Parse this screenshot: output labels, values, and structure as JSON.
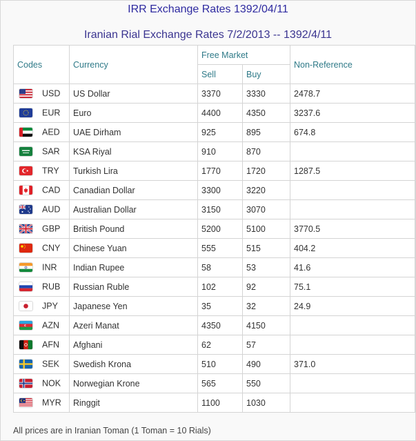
{
  "page": {
    "title": "IRR Exchange Rates 1392/04/11",
    "subtitle": "Iranian Rial Exchange Rates 7/2/2013 -- 1392/4/11",
    "footer": "All prices are in Iranian Toman (1 Toman = 10 Rials)"
  },
  "headers": {
    "codes": "Codes",
    "currency": "Currency",
    "free_market": "Free Market",
    "sell": "Sell",
    "buy": "Buy",
    "non_reference": "Non-Reference"
  },
  "rows": [
    {
      "flag": "us-flag-icon",
      "code": "USD",
      "currency": "US Dollar",
      "sell": "3370",
      "buy": "3330",
      "nonref": "2478.7"
    },
    {
      "flag": "eu-flag-icon",
      "code": "EUR",
      "currency": "Euro",
      "sell": "4400",
      "buy": "4350",
      "nonref": "3237.6"
    },
    {
      "flag": "ae-flag-icon",
      "code": "AED",
      "currency": "UAE Dirham",
      "sell": "925",
      "buy": "895",
      "nonref": "674.8"
    },
    {
      "flag": "sa-flag-icon",
      "code": "SAR",
      "currency": "KSA Riyal",
      "sell": "910",
      "buy": "870",
      "nonref": ""
    },
    {
      "flag": "tr-flag-icon",
      "code": "TRY",
      "currency": "Turkish Lira",
      "sell": "1770",
      "buy": "1720",
      "nonref": "1287.5"
    },
    {
      "flag": "ca-flag-icon",
      "code": "CAD",
      "currency": "Canadian Dollar",
      "sell": "3300",
      "buy": "3220",
      "nonref": ""
    },
    {
      "flag": "au-flag-icon",
      "code": "AUD",
      "currency": "Australian Dollar",
      "sell": "3150",
      "buy": "3070",
      "nonref": ""
    },
    {
      "flag": "gb-flag-icon",
      "code": "GBP",
      "currency": "British Pound",
      "sell": "5200",
      "buy": "5100",
      "nonref": "3770.5"
    },
    {
      "flag": "cn-flag-icon",
      "code": "CNY",
      "currency": "Chinese Yuan",
      "sell": "555",
      "buy": "515",
      "nonref": "404.2"
    },
    {
      "flag": "in-flag-icon",
      "code": "INR",
      "currency": "Indian Rupee",
      "sell": "58",
      "buy": "53",
      "nonref": "41.6"
    },
    {
      "flag": "ru-flag-icon",
      "code": "RUB",
      "currency": "Russian Ruble",
      "sell": "102",
      "buy": "92",
      "nonref": "75.1"
    },
    {
      "flag": "jp-flag-icon",
      "code": "JPY",
      "currency": "Japanese Yen",
      "sell": "35",
      "buy": "32",
      "nonref": "24.9"
    },
    {
      "flag": "az-flag-icon",
      "code": "AZN",
      "currency": "Azeri Manat",
      "sell": "4350",
      "buy": "4150",
      "nonref": ""
    },
    {
      "flag": "af-flag-icon",
      "code": "AFN",
      "currency": "Afghani",
      "sell": "62",
      "buy": "57",
      "nonref": ""
    },
    {
      "flag": "se-flag-icon",
      "code": "SEK",
      "currency": "Swedish Krona",
      "sell": "510",
      "buy": "490",
      "nonref": "371.0"
    },
    {
      "flag": "no-flag-icon",
      "code": "NOK",
      "currency": "Norwegian Krone",
      "sell": "565",
      "buy": "550",
      "nonref": ""
    },
    {
      "flag": "my-flag-icon",
      "code": "MYR",
      "currency": "Ringgit",
      "sell": "1100",
      "buy": "1030",
      "nonref": ""
    }
  ]
}
